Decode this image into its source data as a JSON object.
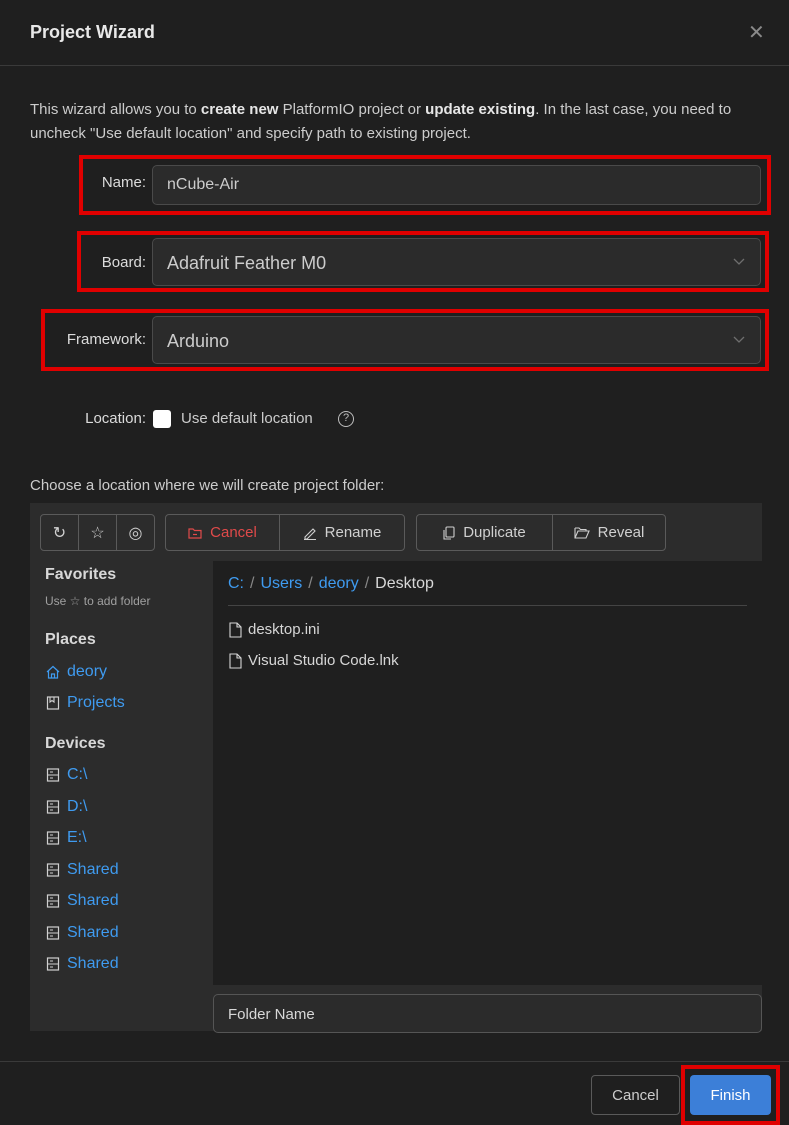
{
  "dialog": {
    "title": "Project Wizard",
    "close_glyph": "✕",
    "intro": {
      "p1": "This wizard allows you to ",
      "b1": "create new",
      "p2": " PlatformIO project or ",
      "b2": "update existing",
      "p3": ". In the last case, you need to uncheck \"Use default location\" and specify path to existing project."
    }
  },
  "form": {
    "name": {
      "label": "Name:",
      "value": "nCube-Air"
    },
    "board": {
      "label": "Board:",
      "value": "Adafruit Feather M0"
    },
    "framework": {
      "label": "Framework:",
      "value": "Arduino"
    },
    "location": {
      "label": "Location:",
      "checkbox_label": "Use default location",
      "checked": false,
      "help_glyph": "?"
    }
  },
  "browser": {
    "prompt": "Choose a location where we will create project folder:",
    "toolbar": {
      "refresh_icon": "↻",
      "star_icon": "☆",
      "eye_icon": "◎",
      "cancel": "Cancel",
      "rename": "Rename",
      "duplicate": "Duplicate",
      "reveal": "Reveal"
    },
    "sidebar": {
      "favorites": {
        "title": "Favorites",
        "hint": "Use ☆ to add folder"
      },
      "places": {
        "title": "Places",
        "items": [
          "deory",
          "Projects"
        ]
      },
      "devices": {
        "title": "Devices",
        "items": [
          "C:\\",
          "D:\\",
          "E:\\",
          "Shared",
          "Shared",
          "Shared",
          "Shared"
        ]
      }
    },
    "breadcrumb": [
      "C:",
      "Users",
      "deory",
      "Desktop"
    ],
    "breadcrumb_sep": "/",
    "files": [
      "desktop.ini",
      "Visual Studio Code.lnk"
    ],
    "folder_name_placeholder": "Folder Name"
  },
  "footer": {
    "cancel": "Cancel",
    "finish": "Finish"
  },
  "colors": {
    "accent": "#3c7fd8",
    "link": "#3f9bf0",
    "danger": "#e04a4a",
    "highlight": "#e00000"
  }
}
